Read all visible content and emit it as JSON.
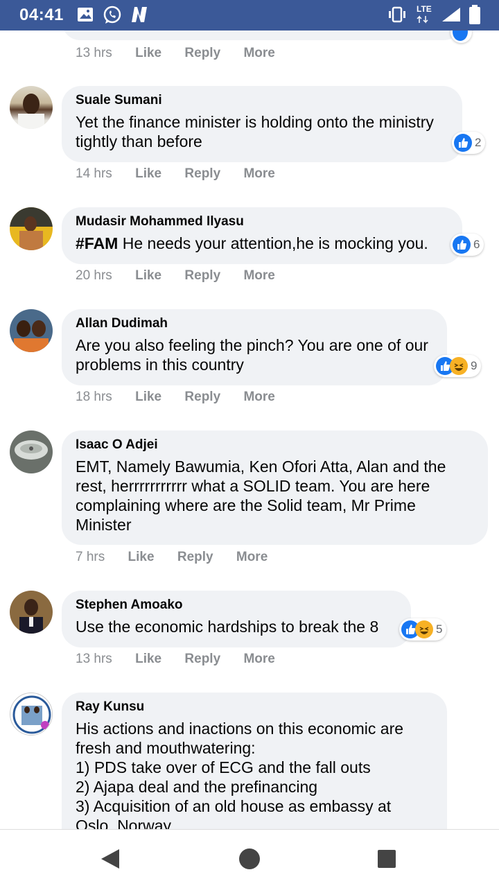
{
  "status_bar": {
    "time": "04:41",
    "network": "LTE"
  },
  "comments": [
    {
      "author": "",
      "text": "",
      "time": "13 hrs",
      "like": "Like",
      "reply": "Reply",
      "more": "More",
      "reaction_count": ""
    },
    {
      "author": "Suale Sumani",
      "text": "Yet the finance minister is holding onto the ministry tightly than before",
      "time": "14 hrs",
      "like": "Like",
      "reply": "Reply",
      "more": "More",
      "reaction_count": "2"
    },
    {
      "author": "Mudasir Mohammed Ilyasu",
      "text_tag": "#FAM",
      "text": "He needs your attention,he is mocking you.",
      "time": "20 hrs",
      "like": "Like",
      "reply": "Reply",
      "more": "More",
      "reaction_count": "6"
    },
    {
      "author": "Allan Dudimah",
      "text": "Are you also feeling the pinch? You are one of our problems in this country",
      "time": "18 hrs",
      "like": "Like",
      "reply": "Reply",
      "more": "More",
      "reaction_count": "9"
    },
    {
      "author": "Isaac O Adjei",
      "text": "EMT, Namely Bawumia, Ken Ofori Atta, Alan and the rest, herrrrrrrrrrr what a SOLID team. You are here complaining where are the Solid team, Mr Prime Minister",
      "time": "7 hrs",
      "like": "Like",
      "reply": "Reply",
      "more": "More",
      "reaction_count": ""
    },
    {
      "author": "Stephen Amoako",
      "text": "Use the economic hardships to break the 8",
      "time": "13 hrs",
      "like": "Like",
      "reply": "Reply",
      "more": "More",
      "reaction_count": "5"
    },
    {
      "author": "Ray Kunsu",
      "text_lines": [
        "His actions and inactions on this economic are",
        "fresh and mouthwatering:",
        "1) PDS take over of ECG and the fall outs",
        "2) Ajapa deal and the prefinancing",
        "3) Acquisition of an old house as embassy at",
        "Oslo, Norway"
      ]
    }
  ]
}
